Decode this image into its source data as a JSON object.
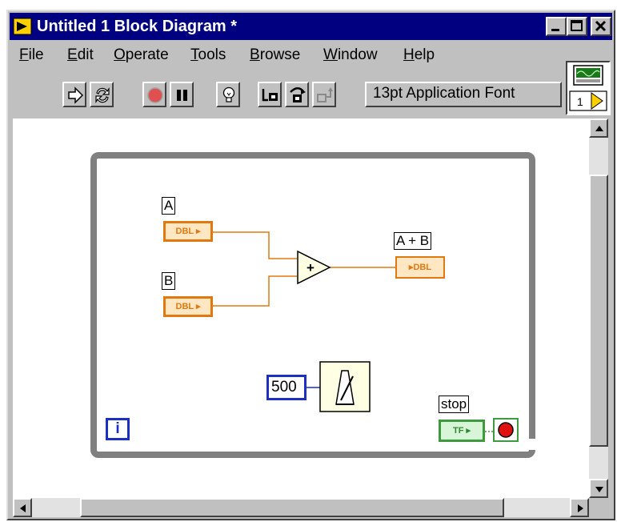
{
  "window": {
    "title": "Untitled 1 Block Diagram *",
    "colors": {
      "titlebar": "#000080",
      "face": "#c0c0c0",
      "wire_orange": "#e07a10",
      "loop_gray": "#808080",
      "const_blue": "#1c2fc0",
      "bool_green": "#3f9a3f"
    }
  },
  "menu": [
    {
      "mnemonic": "F",
      "rest": "ile"
    },
    {
      "mnemonic": "E",
      "rest": "dit"
    },
    {
      "mnemonic": "O",
      "rest": "perate"
    },
    {
      "mnemonic": "T",
      "rest": "ools"
    },
    {
      "mnemonic": "B",
      "rest": "rowse"
    },
    {
      "mnemonic": "W",
      "rest": "indow"
    },
    {
      "mnemonic": "H",
      "rest": "elp"
    }
  ],
  "toolbar": {
    "buttons": [
      "run-arrow-icon",
      "run-continuously-icon",
      "abort-stop-icon",
      "pause-icon",
      "highlight-execution-icon",
      "step-into-icon",
      "step-over-icon",
      "step-out-icon"
    ],
    "font_ring": "13pt Application Font"
  },
  "vi_icon": {
    "number": "1"
  },
  "diagram": {
    "controls": [
      {
        "label": "A",
        "type": "DBL"
      },
      {
        "label": "B",
        "type": "DBL"
      }
    ],
    "indicator": {
      "label": "A + B",
      "type": "DBL"
    },
    "add_node": {
      "symbol": "+"
    },
    "wait_constant": "500",
    "iteration_terminal": "i",
    "stop": {
      "label": "stop",
      "type": "TF"
    }
  }
}
